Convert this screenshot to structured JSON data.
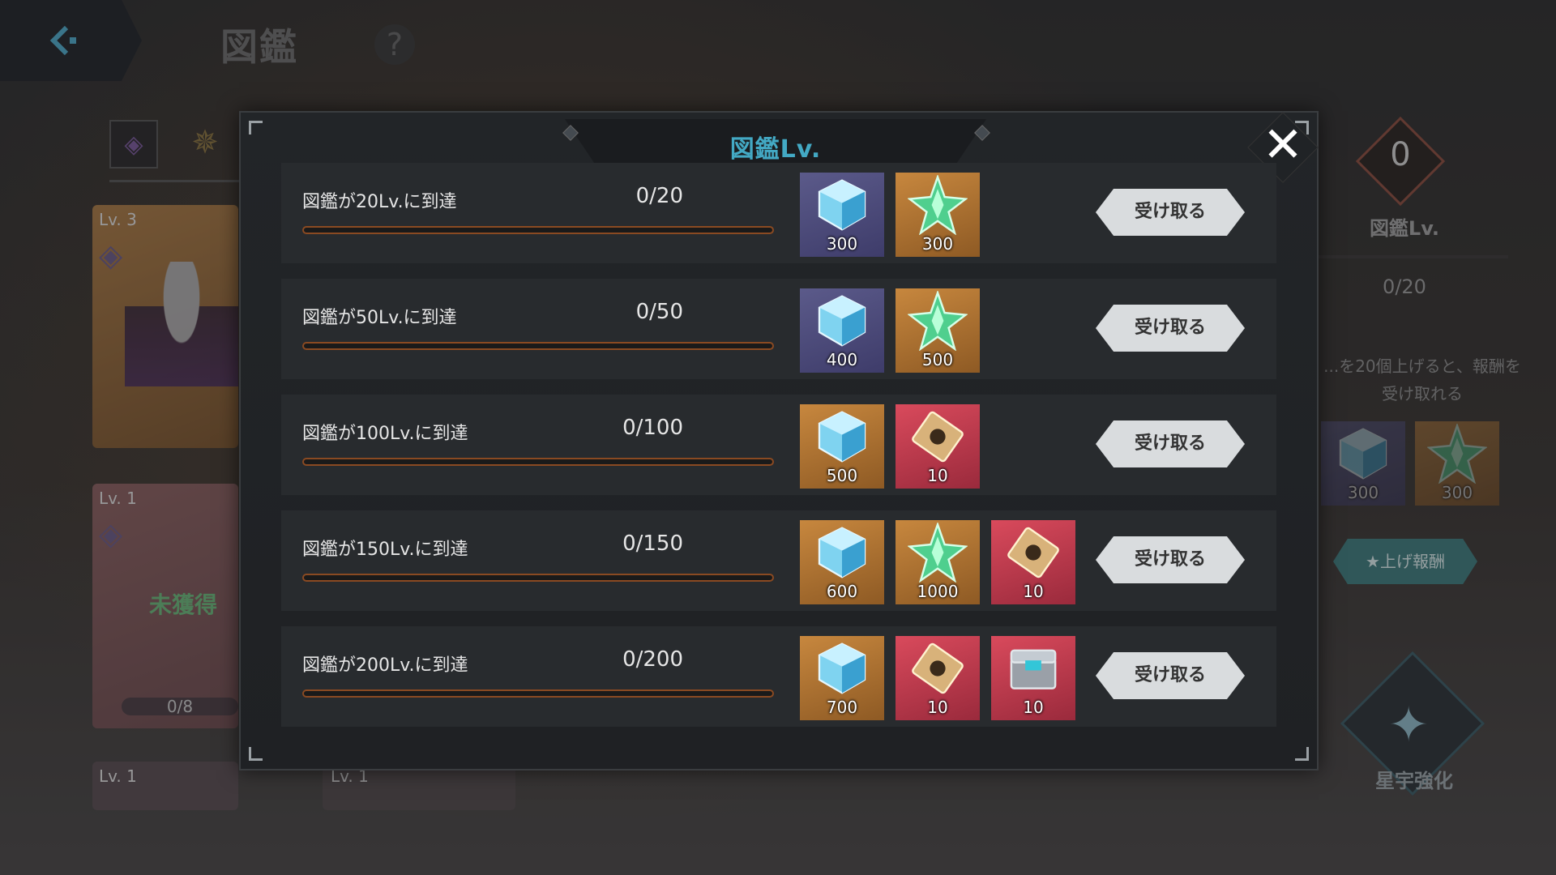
{
  "header": {
    "title": "図鑑",
    "help_label": "?"
  },
  "cards": [
    {
      "level": "Lv. 3"
    },
    {
      "level": "Lv. 1",
      "status": "未獲得",
      "progress": "0/8"
    },
    {
      "level": "Lv. 1"
    },
    {
      "level": "Lv. 1"
    }
  ],
  "side_panel": {
    "level_value": "0",
    "level_label": "図鑑Lv.",
    "progress": "0/20",
    "description": "...を20個上げると、報酬を受け取れる",
    "items": [
      {
        "qty": "300",
        "type": "crystal"
      },
      {
        "qty": "300",
        "type": "star-gem"
      }
    ],
    "reward_button": "★上げ報酬",
    "enhance_label": "星宇強化"
  },
  "modal": {
    "title": "図鑑Lv.",
    "close_label": "✕",
    "claim_label": "受け取る",
    "rows": [
      {
        "label": "図鑑が20Lv.に到達",
        "count": "0/20",
        "progress": 0,
        "items": [
          {
            "type": "crystal",
            "bg": "purple",
            "qty": "300"
          },
          {
            "type": "star-gem",
            "bg": "orange",
            "qty": "300"
          }
        ]
      },
      {
        "label": "図鑑が50Lv.に到達",
        "count": "0/50",
        "progress": 0,
        "items": [
          {
            "type": "crystal",
            "bg": "purple",
            "qty": "400"
          },
          {
            "type": "star-gem",
            "bg": "orange",
            "qty": "500"
          }
        ]
      },
      {
        "label": "図鑑が100Lv.に到達",
        "count": "0/100",
        "progress": 0,
        "items": [
          {
            "type": "crystal",
            "bg": "orange",
            "qty": "500"
          },
          {
            "type": "ticket",
            "bg": "red",
            "qty": "10"
          }
        ]
      },
      {
        "label": "図鑑が150Lv.に到達",
        "count": "0/150",
        "progress": 0,
        "items": [
          {
            "type": "crystal",
            "bg": "orange",
            "qty": "600"
          },
          {
            "type": "star-gem",
            "bg": "orange",
            "qty": "1000"
          },
          {
            "type": "ticket",
            "bg": "red",
            "qty": "10"
          }
        ]
      },
      {
        "label": "図鑑が200Lv.に到達",
        "count": "0/200",
        "progress": 0,
        "items": [
          {
            "type": "crystal",
            "bg": "orange",
            "qty": "700"
          },
          {
            "type": "ticket",
            "bg": "red",
            "qty": "10"
          },
          {
            "type": "chest",
            "bg": "red",
            "qty": "10"
          }
        ]
      }
    ]
  },
  "colors": {
    "accent": "#43a9c4",
    "bar_border": "#8a4a22",
    "button_bg": "#d9dcde"
  }
}
